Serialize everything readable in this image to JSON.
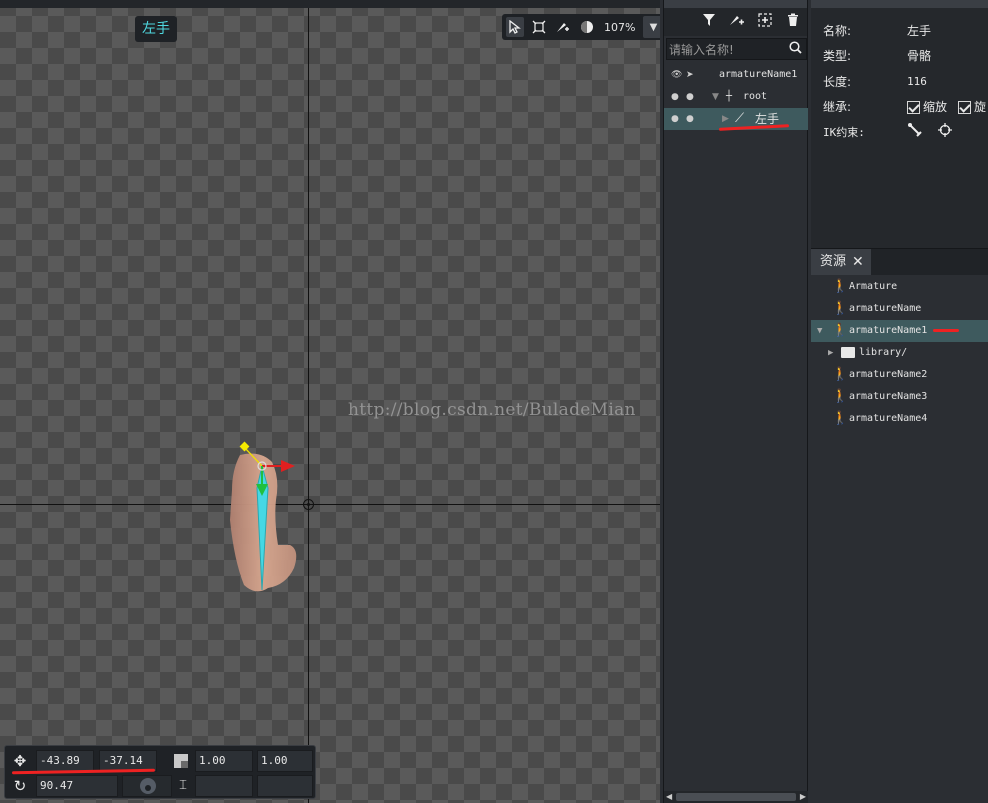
{
  "canvas": {
    "bone_label": "左手",
    "zoom": "107%",
    "watermark": "http://blog.csdn.net/BuladeMian"
  },
  "transform": {
    "pos_x": "-43.89",
    "pos_y": "-37.14",
    "scale_x": "1.00",
    "scale_y": "1.00",
    "rotation": "90.47"
  },
  "tree": {
    "search_placeholder": "请输入名称!",
    "items": [
      {
        "label": "armatureName1"
      },
      {
        "label": "root"
      },
      {
        "label": "左手"
      }
    ]
  },
  "props": {
    "name_label": "名称:",
    "name_value": "左手",
    "type_label": "类型:",
    "type_value": "骨骼",
    "length_label": "长度:",
    "length_value": "116",
    "inherit_label": "继承:",
    "inherit_scale": "缩放",
    "inherit_rotate": "旋",
    "ik_label": "IK约束:"
  },
  "resources": {
    "tab": "资源",
    "items": [
      {
        "label": "Armature"
      },
      {
        "label": "armatureName"
      },
      {
        "label": "armatureName1"
      },
      {
        "label": "library/"
      },
      {
        "label": "armatureName2"
      },
      {
        "label": "armatureName3"
      },
      {
        "label": "armatureName4"
      }
    ]
  },
  "colors": {
    "accent_cyan": "#4fd8e0",
    "selection": "#3e5a5e",
    "annotation_red": "#ee2222"
  }
}
